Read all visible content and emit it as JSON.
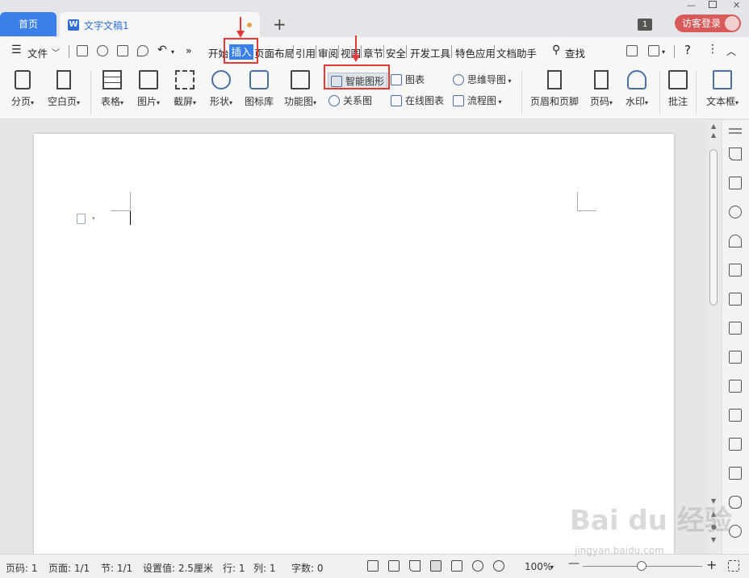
{
  "titlebar": {
    "home_tab": "首页",
    "doc_tab": "文字文稿1",
    "doc_icon": "W",
    "new_tab": "+",
    "window_count": "1",
    "login_label": "访客登录"
  },
  "menubar": {
    "file_label": "文件",
    "items": [
      "开始",
      "插入",
      "页面布局",
      "引用",
      "审阅",
      "视图",
      "章节",
      "安全",
      "开发工具",
      "特色应用",
      "文档助手"
    ],
    "search_label": "查找",
    "more_label": "»"
  },
  "ribbon": {
    "page_break": "分页",
    "blank_page": "空白页",
    "table": "表格",
    "picture": "图片",
    "screenshot": "截屏",
    "shape": "形状",
    "icon_lib": "图标库",
    "function_chart": "功能图",
    "smart_art": "智能图形",
    "relation_chart": "关系图",
    "chart": "图表",
    "online_chart": "在线图表",
    "mind_map": "思维导图",
    "flow_chart": "流程图",
    "header_footer": "页眉和页脚",
    "page_number": "页码",
    "watermark": "水印",
    "comment": "批注",
    "text_box": "文本框"
  },
  "status": {
    "page_code": "页码: 1",
    "pages": "页面: 1/1",
    "section": "节: 1/1",
    "setting": "设置值: 2.5厘米",
    "row": "行: 1",
    "col": "列: 1",
    "word_count": "字数: 0",
    "zoom": "100%",
    "zoom_fraction": 0.5
  },
  "watermark": {
    "brand": "Bai du 经验",
    "url": "jingyan.baidu.com"
  }
}
